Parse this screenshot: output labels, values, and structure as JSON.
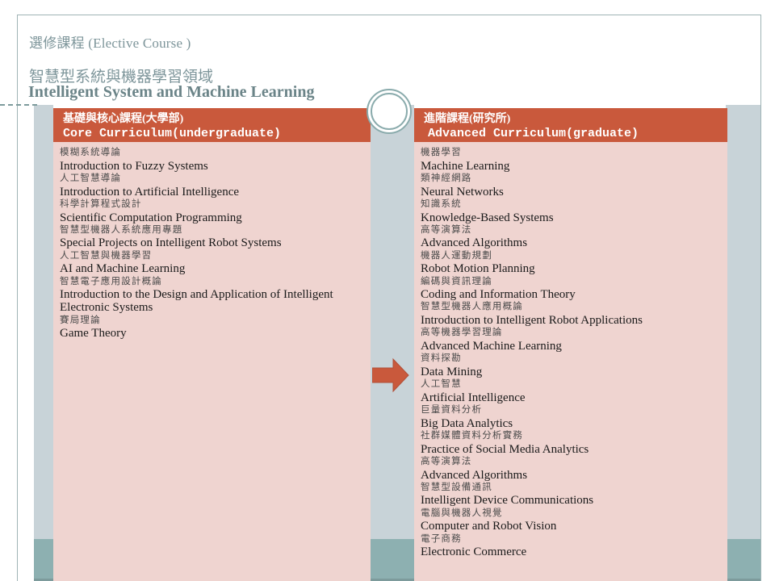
{
  "slide": {
    "elective_label": "選修課程 (Elective Course )",
    "field_zh": "智慧型系統與機器學習領域",
    "field_en": "Intelligent System and Machine Learning",
    "colors": {
      "header_bar": "#C9593C",
      "column_body": "#EFD4D0",
      "band": "#C8D3D8",
      "band_foot": "#8DB0B1",
      "title_text": "#7D959A",
      "arrow": "#C9593C",
      "ring": "#8AABAC"
    }
  },
  "columns": [
    {
      "id": "core-curriculum",
      "header_zh": "基礎與核心課程(大學部)",
      "header_en": "Core Curriculum(undergraduate)",
      "courses": [
        {
          "zh": "模糊系統導論",
          "en": "Introduction to Fuzzy Systems"
        },
        {
          "zh": "人工智慧導論",
          "en": "Introduction to Artificial Intelligence"
        },
        {
          "zh": "科學計算程式設計",
          "en": "Scientific Computation Programming"
        },
        {
          "zh": "智慧型機器人系統應用專題",
          "en": "Special Projects on Intelligent Robot Systems"
        },
        {
          "zh": "人工智慧與機器學習",
          "en": "AI and Machine Learning"
        },
        {
          "zh": "智慧電子應用設計概論",
          "en": "Introduction to the Design and Application of Intelligent Electronic Systems"
        },
        {
          "zh": "賽局理論",
          "en": "Game Theory"
        }
      ]
    },
    {
      "id": "advanced-curriculum",
      "header_zh": "進階課程(研究所)",
      "header_en": "Advanced Curriculum(graduate)",
      "courses": [
        {
          "zh": "機器學習",
          "en": "Machine Learning"
        },
        {
          "zh": "類神經網路",
          "en": "Neural Networks"
        },
        {
          "zh": "知識系統",
          "en": "Knowledge-Based Systems"
        },
        {
          "zh": "高等演算法",
          "en": "Advanced Algorithms"
        },
        {
          "zh": "機器人運動規劃",
          "en": "Robot Motion Planning"
        },
        {
          "zh": "編碼與資訊理論",
          "en": "Coding and Information Theory"
        },
        {
          "zh": "智慧型機器人應用概論",
          "en": "Introduction to Intelligent Robot Applications"
        },
        {
          "zh": "高等機器學習理論",
          "en": "Advanced Machine Learning"
        },
        {
          "zh": "資料探勘",
          "en": "Data Mining"
        },
        {
          "zh": "人工智慧",
          "en": "Artificial Intelligence"
        },
        {
          "zh": "巨量資料分析",
          "en": "Big Data Analytics"
        },
        {
          "zh": "社群媒體資料分析實務",
          "en": "Practice of Social Media Analytics"
        },
        {
          "zh": "高等演算法",
          "en": "Advanced Algorithms"
        },
        {
          "zh": "智慧型設備通訊",
          "en": "Intelligent Device Communications"
        },
        {
          "zh": "電腦與機器人視覺",
          "en": "Computer and Robot Vision"
        },
        {
          "zh": "電子商務",
          "en": "Electronic Commerce"
        }
      ]
    }
  ],
  "decorations": {
    "circle_name": "double-ring-circle",
    "arrow_name": "right-arrow",
    "arrow_direction": "right"
  }
}
